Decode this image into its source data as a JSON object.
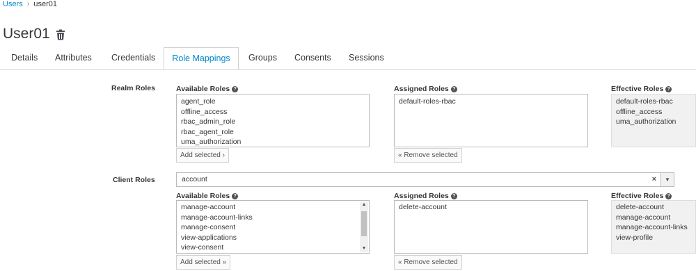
{
  "breadcrumb": {
    "users_link": "Users",
    "separator": "›",
    "current": "user01"
  },
  "page": {
    "title": "User01"
  },
  "tabs": [
    {
      "label": "Details"
    },
    {
      "label": "Attributes"
    },
    {
      "label": "Credentials"
    },
    {
      "label": "Role Mappings",
      "active": true
    },
    {
      "label": "Groups"
    },
    {
      "label": "Consents"
    },
    {
      "label": "Sessions"
    }
  ],
  "realm": {
    "section_label": "Realm Roles",
    "available_label": "Available Roles",
    "assigned_label": "Assigned Roles",
    "effective_label": "Effective Roles",
    "available": [
      "agent_role",
      "offline_access",
      "rbac_admin_role",
      "rbac_agent_role",
      "uma_authorization"
    ],
    "assigned": [
      "default-roles-rbac"
    ],
    "effective": [
      "default-roles-rbac",
      "offline_access",
      "uma_authorization"
    ],
    "add_button": "Add selected ›",
    "remove_button": "« Remove selected"
  },
  "client": {
    "section_label": "Client Roles",
    "selected_client": "account",
    "clear_glyph": "×",
    "dropdown_glyph": "▼",
    "available_label": "Available Roles",
    "assigned_label": "Assigned Roles",
    "effective_label": "Effective Roles",
    "available": [
      "manage-account",
      "manage-account-links",
      "manage-consent",
      "view-applications",
      "view-consent"
    ],
    "assigned": [
      "delete-account"
    ],
    "effective": [
      "delete-account",
      "manage-account",
      "manage-account-links",
      "view-profile"
    ],
    "add_button": "Add selected »",
    "remove_button": "« Remove selected"
  },
  "help_glyph": "?",
  "colors": {
    "link": "#0088ce",
    "text": "#363636",
    "border": "#bbbbbb",
    "effective_bg": "#f1f1f1"
  },
  "icons": [
    "trash-icon",
    "help-icon",
    "clear-icon",
    "chevron-down-icon",
    "scroll-up-icon",
    "scroll-down-icon"
  ]
}
